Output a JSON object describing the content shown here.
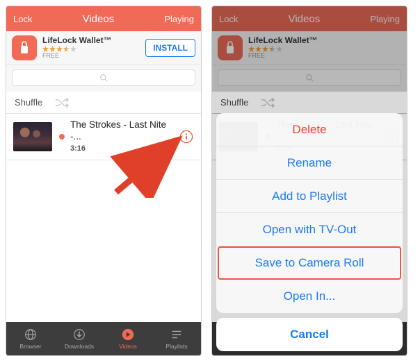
{
  "nav": {
    "left": "Lock",
    "title": "Videos",
    "right": "Playing"
  },
  "ad": {
    "title": "LifeLock Wallet™",
    "price": "FREE",
    "cta": "INSTALL",
    "stars": 3.5
  },
  "search": {
    "placeholder": ""
  },
  "shuffle": {
    "label": "Shuffle"
  },
  "items": [
    {
      "title": "The Strokes - Last Nite -...",
      "duration": "3:16"
    }
  ],
  "tabs": {
    "browser": "Browser",
    "downloads": "Downloads",
    "videos": "Videos",
    "playlists": "Playlists"
  },
  "sheet": {
    "delete": "Delete",
    "rename": "Rename",
    "add": "Add to Playlist",
    "tvout": "Open with TV-Out",
    "save": "Save to Camera Roll",
    "openin": "Open In...",
    "cancel": "Cancel"
  }
}
